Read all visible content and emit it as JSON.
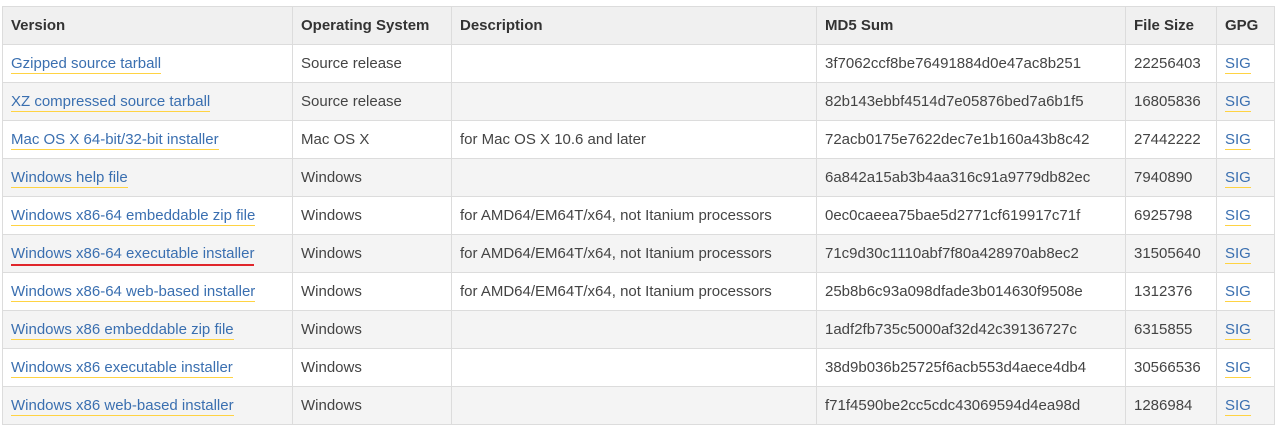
{
  "table": {
    "headers": {
      "version": "Version",
      "os": "Operating System",
      "description": "Description",
      "md5": "MD5 Sum",
      "size": "File Size",
      "gpg": "GPG"
    },
    "rows": [
      {
        "version": "Gzipped source tarball",
        "os": "Source release",
        "description": "",
        "md5": "3f7062ccf8be76491884d0e47ac8b251",
        "size": "22256403",
        "gpg": "SIG",
        "underline": "yellow"
      },
      {
        "version": "XZ compressed source tarball",
        "os": "Source release",
        "description": "",
        "md5": "82b143ebbf4514d7e05876bed7a6b1f5",
        "size": "16805836",
        "gpg": "SIG",
        "underline": "yellow"
      },
      {
        "version": "Mac OS X 64-bit/32-bit installer",
        "os": "Mac OS X",
        "description": "for Mac OS X 10.6 and later",
        "md5": "72acb0175e7622dec7e1b160a43b8c42",
        "size": "27442222",
        "gpg": "SIG",
        "underline": "yellow"
      },
      {
        "version": "Windows help file",
        "os": "Windows",
        "description": "",
        "md5": "6a842a15ab3b4aa316c91a9779db82ec",
        "size": "7940890",
        "gpg": "SIG",
        "underline": "yellow"
      },
      {
        "version": "Windows x86-64 embeddable zip file",
        "os": "Windows",
        "description": "for AMD64/EM64T/x64, not Itanium processors",
        "md5": "0ec0caeea75bae5d2771cf619917c71f",
        "size": "6925798",
        "gpg": "SIG",
        "underline": "yellow"
      },
      {
        "version": "Windows x86-64 executable installer",
        "os": "Windows",
        "description": "for AMD64/EM64T/x64, not Itanium processors",
        "md5": "71c9d30c1110abf7f80a428970ab8ec2",
        "size": "31505640",
        "gpg": "SIG",
        "underline": "red"
      },
      {
        "version": "Windows x86-64 web-based installer",
        "os": "Windows",
        "description": "for AMD64/EM64T/x64, not Itanium processors",
        "md5": "25b8b6c93a098dfade3b014630f9508e",
        "size": "1312376",
        "gpg": "SIG",
        "underline": "yellow"
      },
      {
        "version": "Windows x86 embeddable zip file",
        "os": "Windows",
        "description": "",
        "md5": "1adf2fb735c5000af32d42c39136727c",
        "size": "6315855",
        "gpg": "SIG",
        "underline": "yellow"
      },
      {
        "version": "Windows x86 executable installer",
        "os": "Windows",
        "description": "",
        "md5": "38d9b036b25725f6acb553d4aece4db4",
        "size": "30566536",
        "gpg": "SIG",
        "underline": "yellow"
      },
      {
        "version": "Windows x86 web-based installer",
        "os": "Windows",
        "description": "",
        "md5": "f71f4590be2cc5cdc43069594d4ea98d",
        "size": "1286984",
        "gpg": "SIG",
        "underline": "yellow"
      }
    ]
  },
  "colors": {
    "link": "#3a6fb0",
    "link_underline": "#ffd343",
    "highlight_underline": "#e0262b",
    "header_bg": "#f0f0f0",
    "row_alt_bg": "#f4f4f4",
    "border": "#dcdcdc"
  }
}
